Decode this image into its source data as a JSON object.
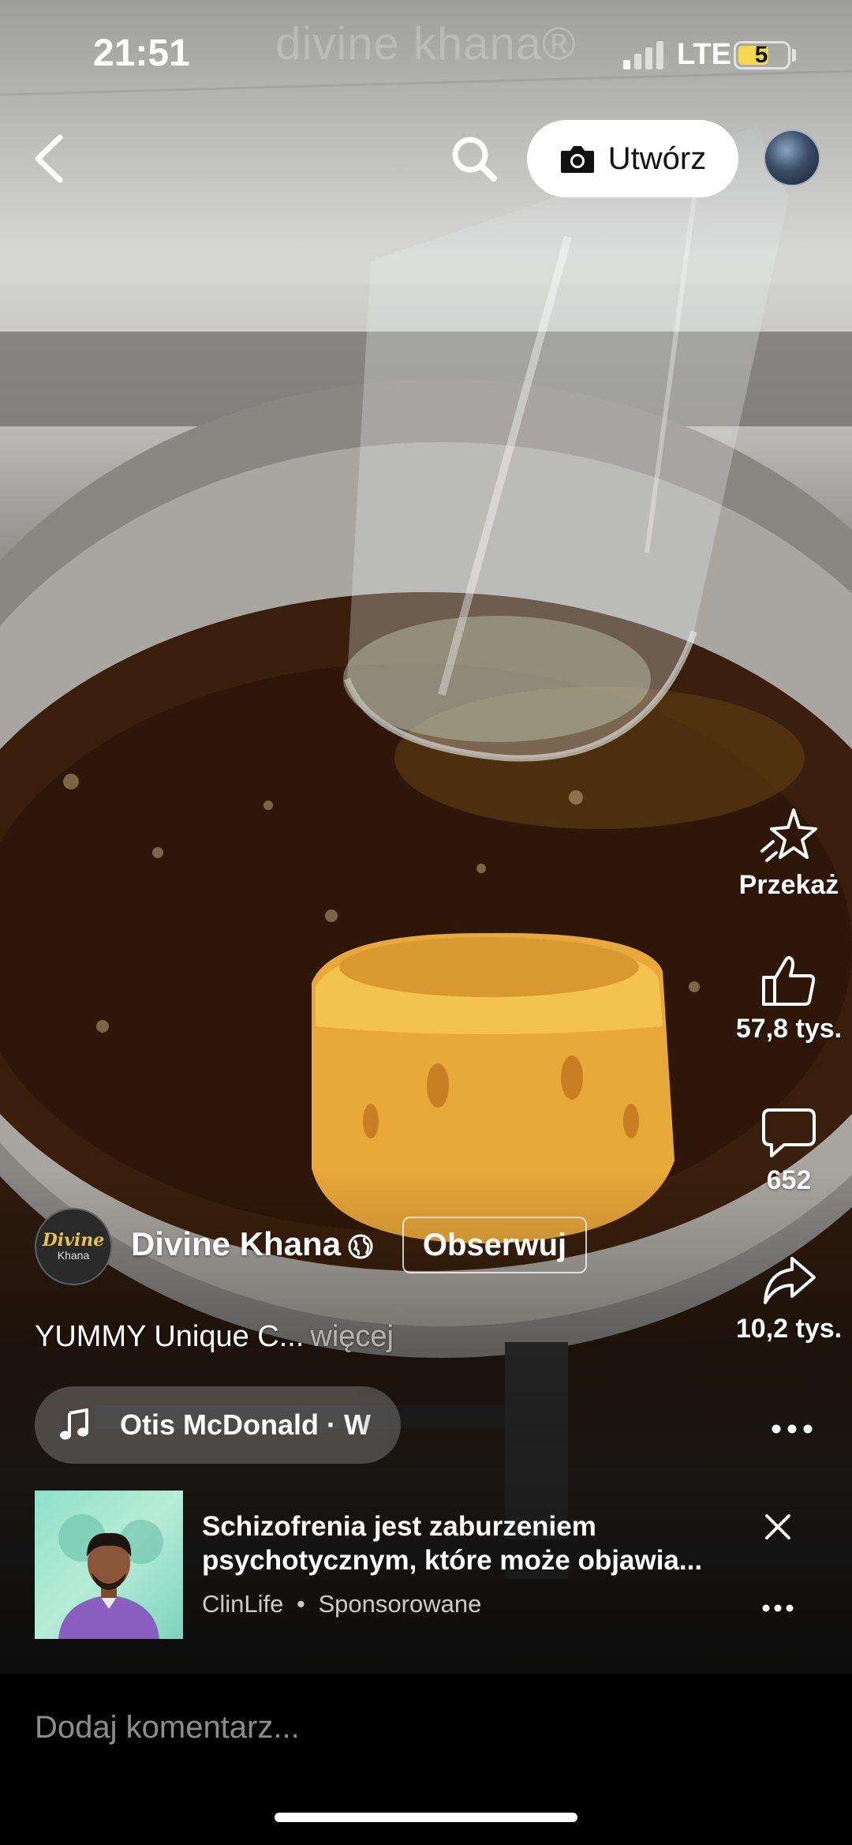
{
  "status_bar": {
    "time": "21:51",
    "network": "LTE",
    "battery": "5",
    "battery_color": "#f6d94a"
  },
  "watermark": "divine khana®",
  "top_bar": {
    "back_icon": "chevron-left-icon",
    "search_icon": "search-icon",
    "create_label": "Utwórz",
    "create_icon": "camera-icon"
  },
  "rail": {
    "boost_label": "Przekaż",
    "likes": "57,8 tys.",
    "comments": "652",
    "shares": "10,2 tys."
  },
  "author": {
    "avatar_line1": "Divine",
    "avatar_line2": "Khana",
    "name": "Divine Khana",
    "follow_label": "Obserwuj"
  },
  "caption": {
    "text": "YUMMY Unique C...",
    "more": "więcej"
  },
  "music": {
    "text": "Otis McDonald · W"
  },
  "ad": {
    "title": "Schizofrenia jest zaburzeniem psychotycznym, które może objawia...",
    "advertiser": "ClinLife",
    "separator": "•",
    "sponsored": "Sponsorowane"
  },
  "comment": {
    "placeholder": "Dodaj komentarz..."
  },
  "colors": {
    "accent_white": "#ffffff",
    "ad_thumb_bg": "#8fe0c7"
  }
}
